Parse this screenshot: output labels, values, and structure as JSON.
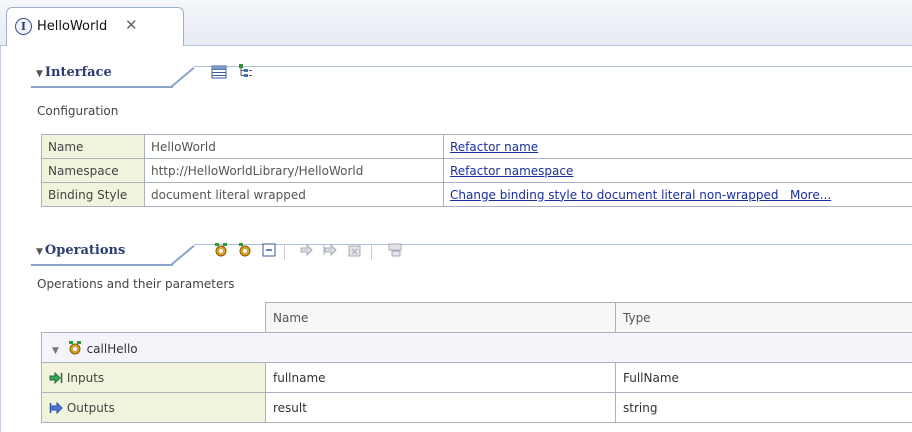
{
  "tab": {
    "title": "HelloWorld",
    "icon": "interface-icon",
    "close": "✕"
  },
  "interface": {
    "title": "Interface",
    "description": "Configuration",
    "toolbar": [
      "table-view-icon",
      "tree-view-icon"
    ],
    "rows": [
      {
        "label": "Name",
        "value": "HelloWorld",
        "action": "Refactor name",
        "extra": ""
      },
      {
        "label": "Namespace",
        "value": "http://HelloWorldLibrary/HelloWorld",
        "action": "Refactor namespace",
        "extra": ""
      },
      {
        "label": "Binding Style",
        "value": "document literal wrapped",
        "action": "Change binding style to document literal non-wrapped",
        "extra": "More..."
      }
    ]
  },
  "operations": {
    "title": "Operations",
    "description": "Operations and their parameters",
    "toolbar": [
      "add-request-response-icon",
      "add-one-way-icon",
      "collapse-icon",
      "add-input-icon",
      "add-output-icon",
      "add-fault-icon",
      "remove-icon"
    ],
    "columns": [
      "Name",
      "Type"
    ],
    "operation": {
      "name": "callHello"
    },
    "params": [
      {
        "kind": "Inputs",
        "name": "fullname",
        "type": "FullName"
      },
      {
        "kind": "Outputs",
        "name": "result",
        "type": "string"
      }
    ]
  },
  "colors": {
    "accent": "#2a3e73",
    "link": "#1a2fa0",
    "labelBg": "#f1f3dc",
    "border": "#aab2c0"
  }
}
